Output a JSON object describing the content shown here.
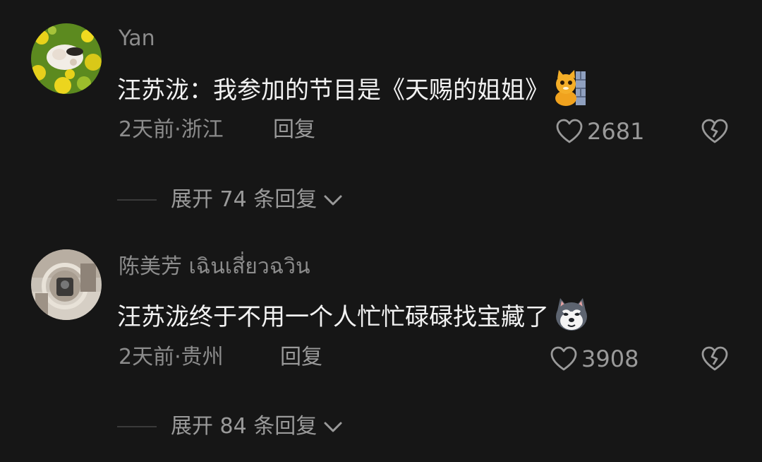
{
  "comments": [
    {
      "username": "Yan",
      "content": "汪苏泷：我参加的节目是《天赐的姐姐》",
      "emoji_icon": "cat-peeking-wall-emoji",
      "meta": "2天前·浙江",
      "reply_label": "回复",
      "likes": "2681",
      "expand_label": "展开 74 条回复"
    },
    {
      "username": "陈美芳 เฉินเสี่ยวฉวิน",
      "content": "汪苏泷终于不用一个人忙忙碌碌找宝藏了",
      "emoji_icon": "husky-dog-emoji",
      "meta": "2天前·贵州",
      "reply_label": "回复",
      "likes": "3908",
      "expand_label": "展开 84 条回复"
    }
  ],
  "colors": {
    "background": "#161616",
    "primary_text": "#f2f2f2",
    "secondary_text": "#8c8c8c"
  }
}
